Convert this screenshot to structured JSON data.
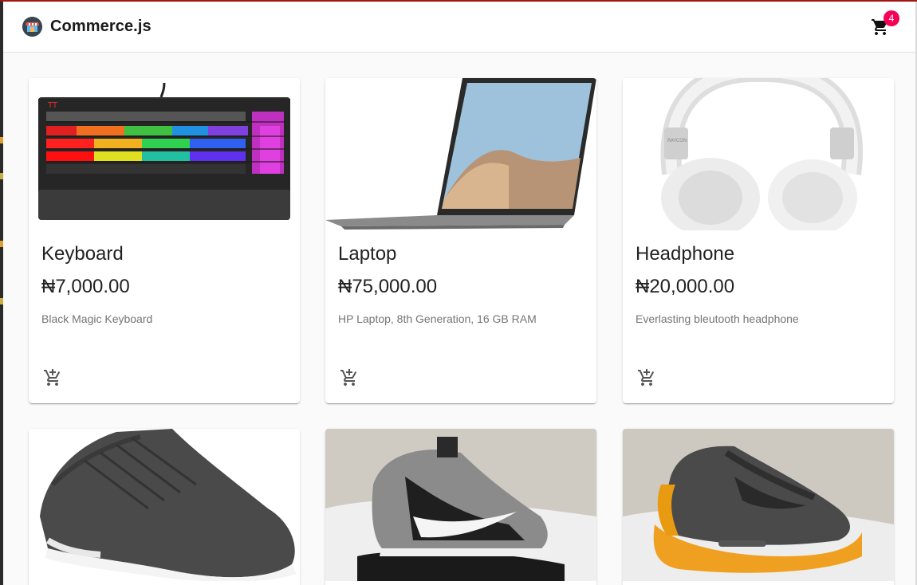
{
  "header": {
    "title": "Commerce.js",
    "cart_count": "4"
  },
  "products": [
    {
      "name": "Keyboard",
      "price": "₦7,000.00",
      "description": "Black Magic Keyboard"
    },
    {
      "name": "Laptop",
      "price": "₦75,000.00",
      "description": "HP Laptop, 8th Generation, 16 GB RAM"
    },
    {
      "name": "Headphone",
      "price": "₦20,000.00",
      "description": "Everlasting bleutooth headphone"
    }
  ],
  "colors": {
    "badge": "#f50057",
    "top_accent": "#a31515"
  },
  "icons": [
    "store-logo-icon",
    "shopping-cart-icon",
    "add-shopping-cart-icon"
  ]
}
